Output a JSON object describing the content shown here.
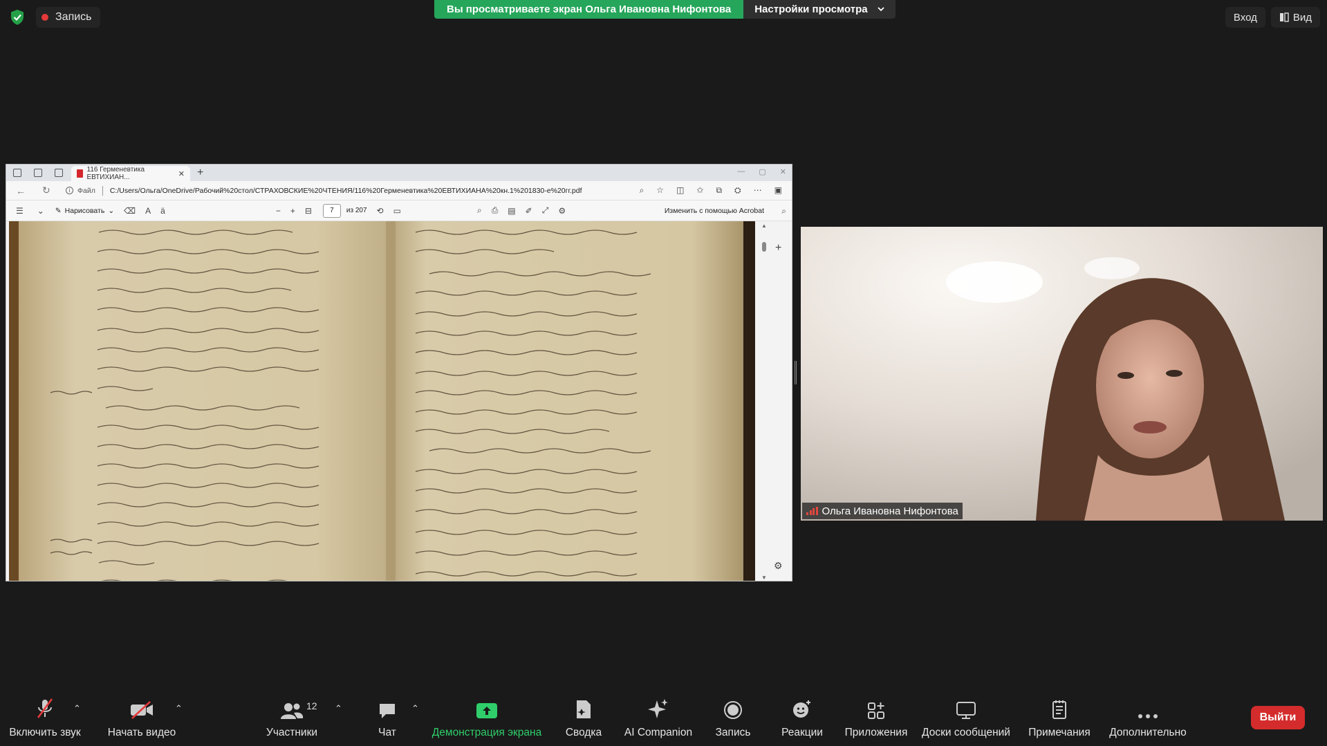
{
  "top": {
    "record_label": "Запись",
    "sharing_banner": "Вы просматриваете экран Ольга Ивановна Нифонтова",
    "view_settings_label": "Настройки просмотра",
    "login_label": "Вход",
    "view_label": "Вид"
  },
  "browser": {
    "tab_title": "116 Герменевтика ЕВТИХИАН...",
    "file_label": "Файл",
    "url": "C:/Users/Ольга/OneDrive/Рабочий%20стол/СТРАХОВСКИЕ%20ЧТЕНИЯ/116%20Герменевтика%20ЕВТИХИАНА%20кн.1%201830-е%20гг.pdf"
  },
  "pdf_toolbar": {
    "draw_label": "Нарисовать",
    "page_current": "7",
    "page_total": "из 207",
    "acrobat_label": "Изменить с помощью Acrobat"
  },
  "video": {
    "participant_name": "Ольга Ивановна Нифонтова"
  },
  "toolbar": {
    "mute_label": "Включить звук",
    "video_label": "Начать видео",
    "participants_label": "Участники",
    "participants_count": "12",
    "chat_label": "Чат",
    "share_label": "Демонстрация экрана",
    "summary_label": "Сводка",
    "ai_label": "AI Companion",
    "record_label": "Запись",
    "reactions_label": "Реакции",
    "apps_label": "Приложения",
    "boards_label": "Доски сообщений",
    "notes_label": "Примечания",
    "more_label": "Дополнительно",
    "leave_label": "Выйти"
  },
  "colors": {
    "share_green": "#26a65b",
    "leave_red": "#d42c2c",
    "record_red": "#e5393a",
    "share_label_green": "#2fce6a"
  }
}
